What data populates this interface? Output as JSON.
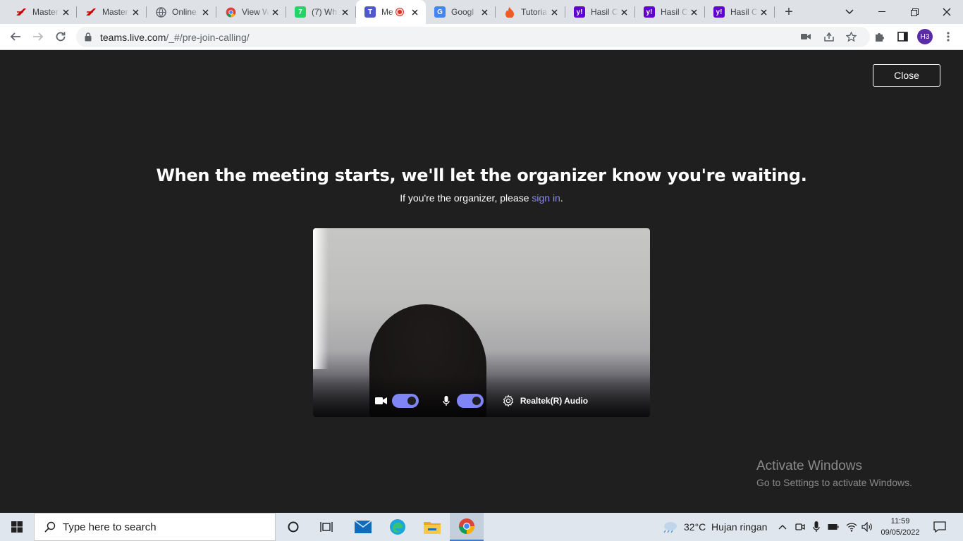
{
  "browser": {
    "tabs": [
      {
        "label": "Master",
        "icon": "honda-icon"
      },
      {
        "label": "Master",
        "icon": "honda-icon"
      },
      {
        "label": "Online",
        "icon": "globe-icon"
      },
      {
        "label": "View W",
        "icon": "chrome-icon"
      },
      {
        "label": "(7) Wh",
        "icon": "whatsapp-icon"
      },
      {
        "label": "Me",
        "icon": "teams-icon",
        "active": true,
        "recording": true
      },
      {
        "label": "Googl",
        "icon": "google-translate-icon"
      },
      {
        "label": "Tutoria",
        "icon": "flame-icon"
      },
      {
        "label": "Hasil C",
        "icon": "yahoo-icon"
      },
      {
        "label": "Hasil C",
        "icon": "yahoo-icon"
      },
      {
        "label": "Hasil C",
        "icon": "yahoo-icon"
      }
    ],
    "url_host": "teams.live.com",
    "url_path": "/_#/pre-join-calling/",
    "profile_initials": "H3"
  },
  "page": {
    "close_label": "Close",
    "headline": "When the meeting starts, we'll let the organizer know you're waiting.",
    "sub_prefix": "If you're the organizer, please ",
    "sub_link": "sign in",
    "sub_suffix": ".",
    "camera_on": true,
    "mic_on": true,
    "audio_device": "Realtek(R) Audio",
    "accent_color": "#7f85f5"
  },
  "watermark": {
    "title": "Activate Windows",
    "subtitle": "Go to Settings to activate Windows."
  },
  "taskbar": {
    "search_placeholder": "Type here to search",
    "weather": "32°C  Hujan ringan",
    "time": "11:59",
    "date": "09/05/2022"
  }
}
